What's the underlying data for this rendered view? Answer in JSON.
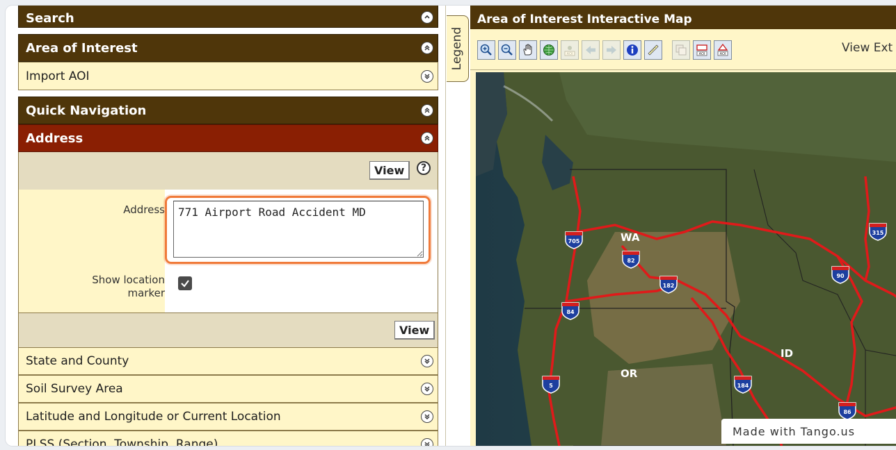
{
  "left_panel": {
    "search_header": "Search",
    "aoi_header": "Area of Interest",
    "import_aoi": "Import AOI",
    "quick_nav_header": "Quick Navigation",
    "address_header": "Address",
    "view_label": "View",
    "help_symbol": "?",
    "address_form": {
      "address_label": "Address",
      "address_value": "771 Airport Road Accident MD",
      "show_marker_label_line1": "Show location",
      "show_marker_label_line2": "marker",
      "show_marker_checked": true
    },
    "sections": [
      "State and County",
      "Soil Survey Area",
      "Latitude and Longitude or Current Location",
      "PLSS (Section, Township, Range)"
    ]
  },
  "legend_tab": "Legend",
  "map_panel": {
    "title": "Area of Interest Interactive Map",
    "view_extent_label": "View Ext",
    "tools": [
      "zoom-in-icon",
      "zoom-out-icon",
      "pan-hand-icon",
      "globe-icon",
      "aoi-disabled-icon",
      "back-arrow-icon",
      "forward-arrow-icon",
      "identify-info-icon",
      "measure-ruler-icon",
      "copy-layers-icon",
      "define-aoi-rectangle-icon",
      "define-aoi-polygon-icon"
    ],
    "map_labels": {
      "state_wa": "WA",
      "state_or": "OR",
      "state_id": "ID"
    },
    "highway_shields": [
      "705",
      "82",
      "182",
      "84",
      "5",
      "184",
      "90",
      "315",
      "86"
    ]
  },
  "watermark": "Made with Tango.us",
  "colors": {
    "header_brown": "#4f360a",
    "header_red": "#8a1f03",
    "row_cream": "#fff6c8",
    "highlight_orange": "#f07a3a",
    "highway_red": "#e01a1a"
  }
}
